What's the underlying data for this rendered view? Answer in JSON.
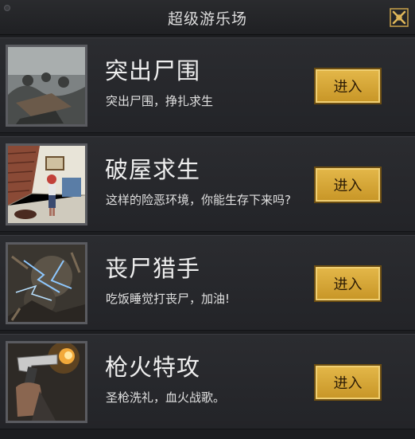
{
  "header": {
    "title": "超级游乐场",
    "close_icon": "close-x-icon"
  },
  "games": [
    {
      "title": "突出尸围",
      "description": "突出尸围，挣扎求生",
      "button": "进入",
      "thumb": "zombie-horde-image"
    },
    {
      "title": "破屋求生",
      "description": "这样的险恶环境，你能生存下来吗?",
      "button": "进入",
      "thumb": "ruined-room-girl-image"
    },
    {
      "title": "丧尸猎手",
      "description": "吃饭睡觉打丧尸，加油!",
      "button": "进入",
      "thumb": "zombie-lightning-image"
    },
    {
      "title": "枪火特攻",
      "description": "圣枪洗礼，血火战歌。",
      "button": "进入",
      "thumb": "pistol-firing-image"
    }
  ],
  "colors": {
    "button_gold": "#d9a93a",
    "background": "#1c1d20"
  }
}
